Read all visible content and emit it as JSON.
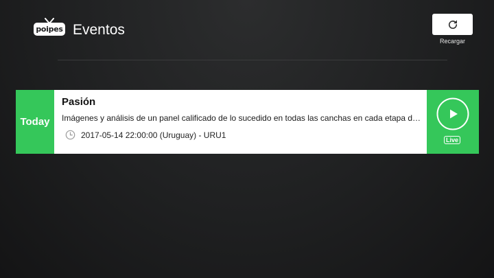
{
  "header": {
    "logo_text": "poipes",
    "title": "Eventos",
    "reload_label": "Recargar"
  },
  "events": [
    {
      "day_label": "Today",
      "title": "Pasión",
      "description": "Imágenes y análisis de un panel calificado de lo sucedido en todas las canchas en cada etapa del fútbol uruguayo.",
      "datetime": "2017-05-14 22:00:00 (Uruguay) - URU1",
      "live_label": "Live"
    }
  ],
  "icons": {
    "logo": "tv-logo-icon",
    "reload": "refresh-icon",
    "clock": "clock-icon",
    "play": "play-circle-icon"
  },
  "colors": {
    "accent_green": "#35c75a",
    "card_background": "#ffffff"
  }
}
